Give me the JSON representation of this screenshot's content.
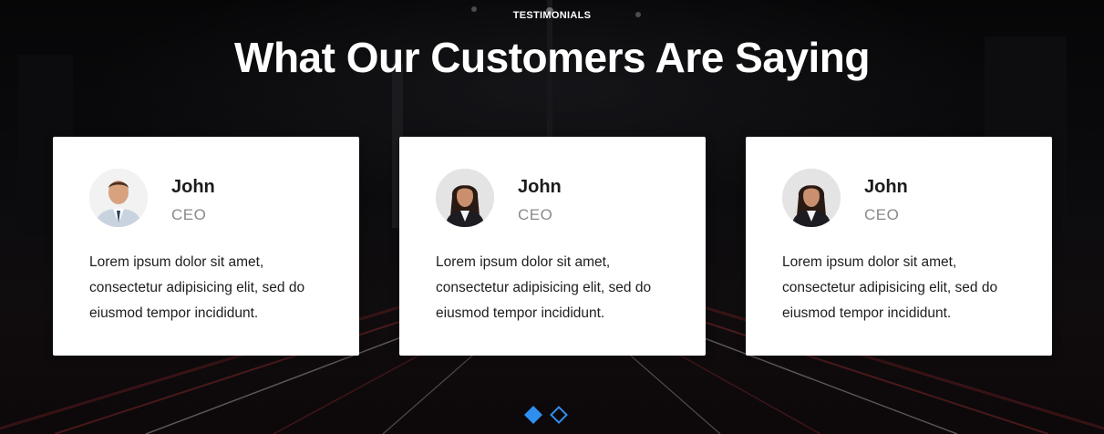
{
  "section": {
    "eyebrow": "TESTIMONIALS",
    "title": "What Our Customers Are Saying"
  },
  "testimonials": [
    {
      "name": "John",
      "role": "CEO",
      "quote": "Lorem ipsum dolor sit amet, consectetur adipisicing elit, sed do eiusmod tempor incididunt.",
      "avatar": "man-in-suit-photo"
    },
    {
      "name": "John",
      "role": "CEO",
      "quote": "Lorem ipsum dolor sit amet, consectetur adipisicing elit, sed do eiusmod tempor incididunt.",
      "avatar": "woman-in-suit-photo"
    },
    {
      "name": "John",
      "role": "CEO",
      "quote": "Lorem ipsum dolor sit amet, consectetur adipisicing elit, sed do eiusmod tempor incididunt.",
      "avatar": "woman-in-suit-photo"
    }
  ],
  "pagination": {
    "pages": 2,
    "active": 1
  },
  "colors": {
    "accent": "#2f8ff0",
    "card_bg": "#ffffff",
    "role_text": "#8a8a8a"
  }
}
